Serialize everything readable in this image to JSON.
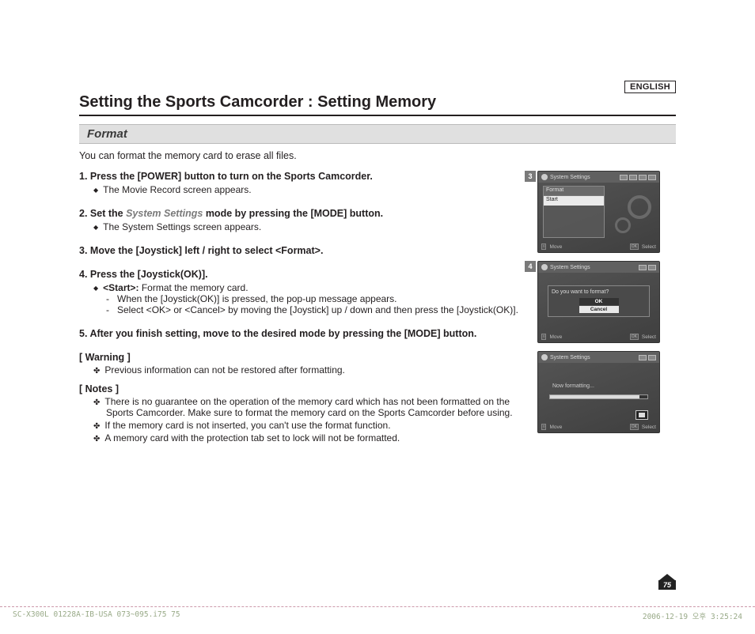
{
  "lang": "ENGLISH",
  "title": "Setting the Sports Camcorder : Setting Memory",
  "section": "Format",
  "intro": "You can format the memory card to erase all files.",
  "steps": {
    "s1": {
      "num": "1.",
      "head": "Press the [POWER] button to turn on the Sports Camcorder.",
      "sub": "The Movie Record screen appears."
    },
    "s2": {
      "num": "2.",
      "head_a": "Set the ",
      "head_ital": "System Settings",
      "head_b": " mode by pressing the [MODE] button.",
      "sub": "The System Settings screen appears."
    },
    "s3": {
      "num": "3.",
      "head": "Move the [Joystick] left / right to select <Format>."
    },
    "s4": {
      "num": "4.",
      "head": "Press the [Joystick(OK)].",
      "sub_bold": "<Start>:",
      "sub_rest": " Format the memory card.",
      "d1": "When the [Joystick(OK)] is pressed, the pop-up message appears.",
      "d2": "Select <OK> or <Cancel> by moving the [Joystick] up / down and then press the [Joystick(OK)]."
    },
    "s5": {
      "num": "5.",
      "head": "After you finish setting, move to the desired mode by pressing the [MODE] button."
    }
  },
  "warning": {
    "head": "[ Warning ]",
    "w1": "Previous information can not be restored after formatting."
  },
  "notes": {
    "head": "[ Notes ]",
    "n1": "There is no guarantee on the operation of the memory card which has not been formatted on the Sports Camcorder. Make sure to format the memory card on the Sports Camcorder before using.",
    "n2": "If the memory card is not inserted, you can't use the format function.",
    "n3": "A memory card with the protection tab set to lock will not be formatted."
  },
  "screens": {
    "s3num": "3",
    "s4num": "4",
    "syslabel": "System Settings",
    "panel_head": "Format",
    "panel_row": "Start",
    "bot_move": "Move",
    "bot_select": "Select",
    "popup_msg": "Do you want to format?",
    "ok": "OK",
    "cancel": "Cancel",
    "formatting": "Now formatting..."
  },
  "page_num": "75",
  "footer": {
    "left": "SC-X300L 01228A-IB-USA 073~095.i75   75",
    "right": "2006-12-19   오후 3:25:24"
  }
}
